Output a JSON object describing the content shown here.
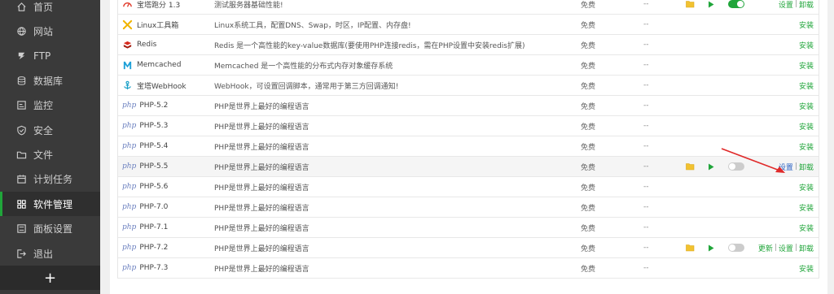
{
  "sidebar": {
    "items": [
      {
        "label": "首页",
        "icon": "home-icon",
        "active": false
      },
      {
        "label": "网站",
        "icon": "globe-icon",
        "active": false
      },
      {
        "label": "FTP",
        "icon": "ftp-icon",
        "active": false
      },
      {
        "label": "数据库",
        "icon": "database-icon",
        "active": false
      },
      {
        "label": "监控",
        "icon": "monitor-icon",
        "active": false
      },
      {
        "label": "安全",
        "icon": "shield-icon",
        "active": false
      },
      {
        "label": "文件",
        "icon": "folder-icon",
        "active": false
      },
      {
        "label": "计划任务",
        "icon": "calendar-icon",
        "active": false
      },
      {
        "label": "软件管理",
        "icon": "apps-icon",
        "active": true
      },
      {
        "label": "面板设置",
        "icon": "settings-icon",
        "active": false
      },
      {
        "label": "退出",
        "icon": "logout-icon",
        "active": false
      }
    ],
    "add_label": "+"
  },
  "table": {
    "rows": [
      {
        "name": "宝塔跑分 1.3",
        "icon": "speedometer-icon",
        "desc": "测试服务器基础性能!",
        "price": "免费",
        "expire": "--",
        "installed": true,
        "toggle": "on",
        "ops": [
          "设置",
          "卸载"
        ]
      },
      {
        "name": "Linux工具箱",
        "icon": "tools-icon",
        "desc": "Linux系统工具，配置DNS、Swap，时区，IP配置、内存盘!",
        "price": "免费",
        "expire": "--",
        "installed": false,
        "ops": [
          "安装"
        ]
      },
      {
        "name": "Redis",
        "icon": "redis-icon",
        "desc": "Redis 是一个高性能的key-value数据库(要使用PHP连接redis，需在PHP设置中安装redis扩展)",
        "price": "免费",
        "expire": "--",
        "installed": false,
        "ops": [
          "安装"
        ]
      },
      {
        "name": "Memcached",
        "icon": "memcached-icon",
        "desc": "Memcached 是一个高性能的分布式内存对象缓存系统",
        "price": "免费",
        "expire": "--",
        "installed": false,
        "ops": [
          "安装"
        ]
      },
      {
        "name": "宝塔WebHook",
        "icon": "webhook-icon",
        "desc": "WebHook，可设置回调脚本，通常用于第三方回调通知!",
        "price": "免费",
        "expire": "--",
        "installed": false,
        "ops": [
          "安装"
        ]
      },
      {
        "name": "PHP-5.2",
        "icon": "php-icon",
        "desc": "PHP是世界上最好的编程语言",
        "price": "免费",
        "expire": "--",
        "installed": false,
        "ops": [
          "安装"
        ]
      },
      {
        "name": "PHP-5.3",
        "icon": "php-icon",
        "desc": "PHP是世界上最好的编程语言",
        "price": "免费",
        "expire": "--",
        "installed": false,
        "ops": [
          "安装"
        ]
      },
      {
        "name": "PHP-5.4",
        "icon": "php-icon",
        "desc": "PHP是世界上最好的编程语言",
        "price": "免费",
        "expire": "--",
        "installed": false,
        "ops": [
          "安装"
        ]
      },
      {
        "name": "PHP-5.5",
        "icon": "php-icon",
        "desc": "PHP是世界上最好的编程语言",
        "price": "免费",
        "expire": "--",
        "installed": true,
        "toggle": "off",
        "ops": [
          "设置",
          "卸载"
        ],
        "highlight": true
      },
      {
        "name": "PHP-5.6",
        "icon": "php-icon",
        "desc": "PHP是世界上最好的编程语言",
        "price": "免费",
        "expire": "--",
        "installed": false,
        "ops": [
          "安装"
        ]
      },
      {
        "name": "PHP-7.0",
        "icon": "php-icon",
        "desc": "PHP是世界上最好的编程语言",
        "price": "免费",
        "expire": "--",
        "installed": false,
        "ops": [
          "安装"
        ]
      },
      {
        "name": "PHP-7.1",
        "icon": "php-icon",
        "desc": "PHP是世界上最好的编程语言",
        "price": "免费",
        "expire": "--",
        "installed": false,
        "ops": [
          "安装"
        ]
      },
      {
        "name": "PHP-7.2",
        "icon": "php-icon",
        "desc": "PHP是世界上最好的编程语言",
        "price": "免费",
        "expire": "--",
        "installed": true,
        "toggle": "off",
        "ops": [
          "更新",
          "设置",
          "卸载"
        ]
      },
      {
        "name": "PHP-7.3",
        "icon": "php-icon",
        "desc": "PHP是世界上最好的编程语言",
        "price": "免费",
        "expire": "--",
        "installed": false,
        "ops": [
          "安装"
        ]
      }
    ]
  },
  "php_icon_text": "php",
  "colors": {
    "accent": "#20a53a",
    "link_blue": "#2b62c4",
    "arrow": "#e02a2a",
    "sidebar_bg": "#3a3a3a"
  }
}
